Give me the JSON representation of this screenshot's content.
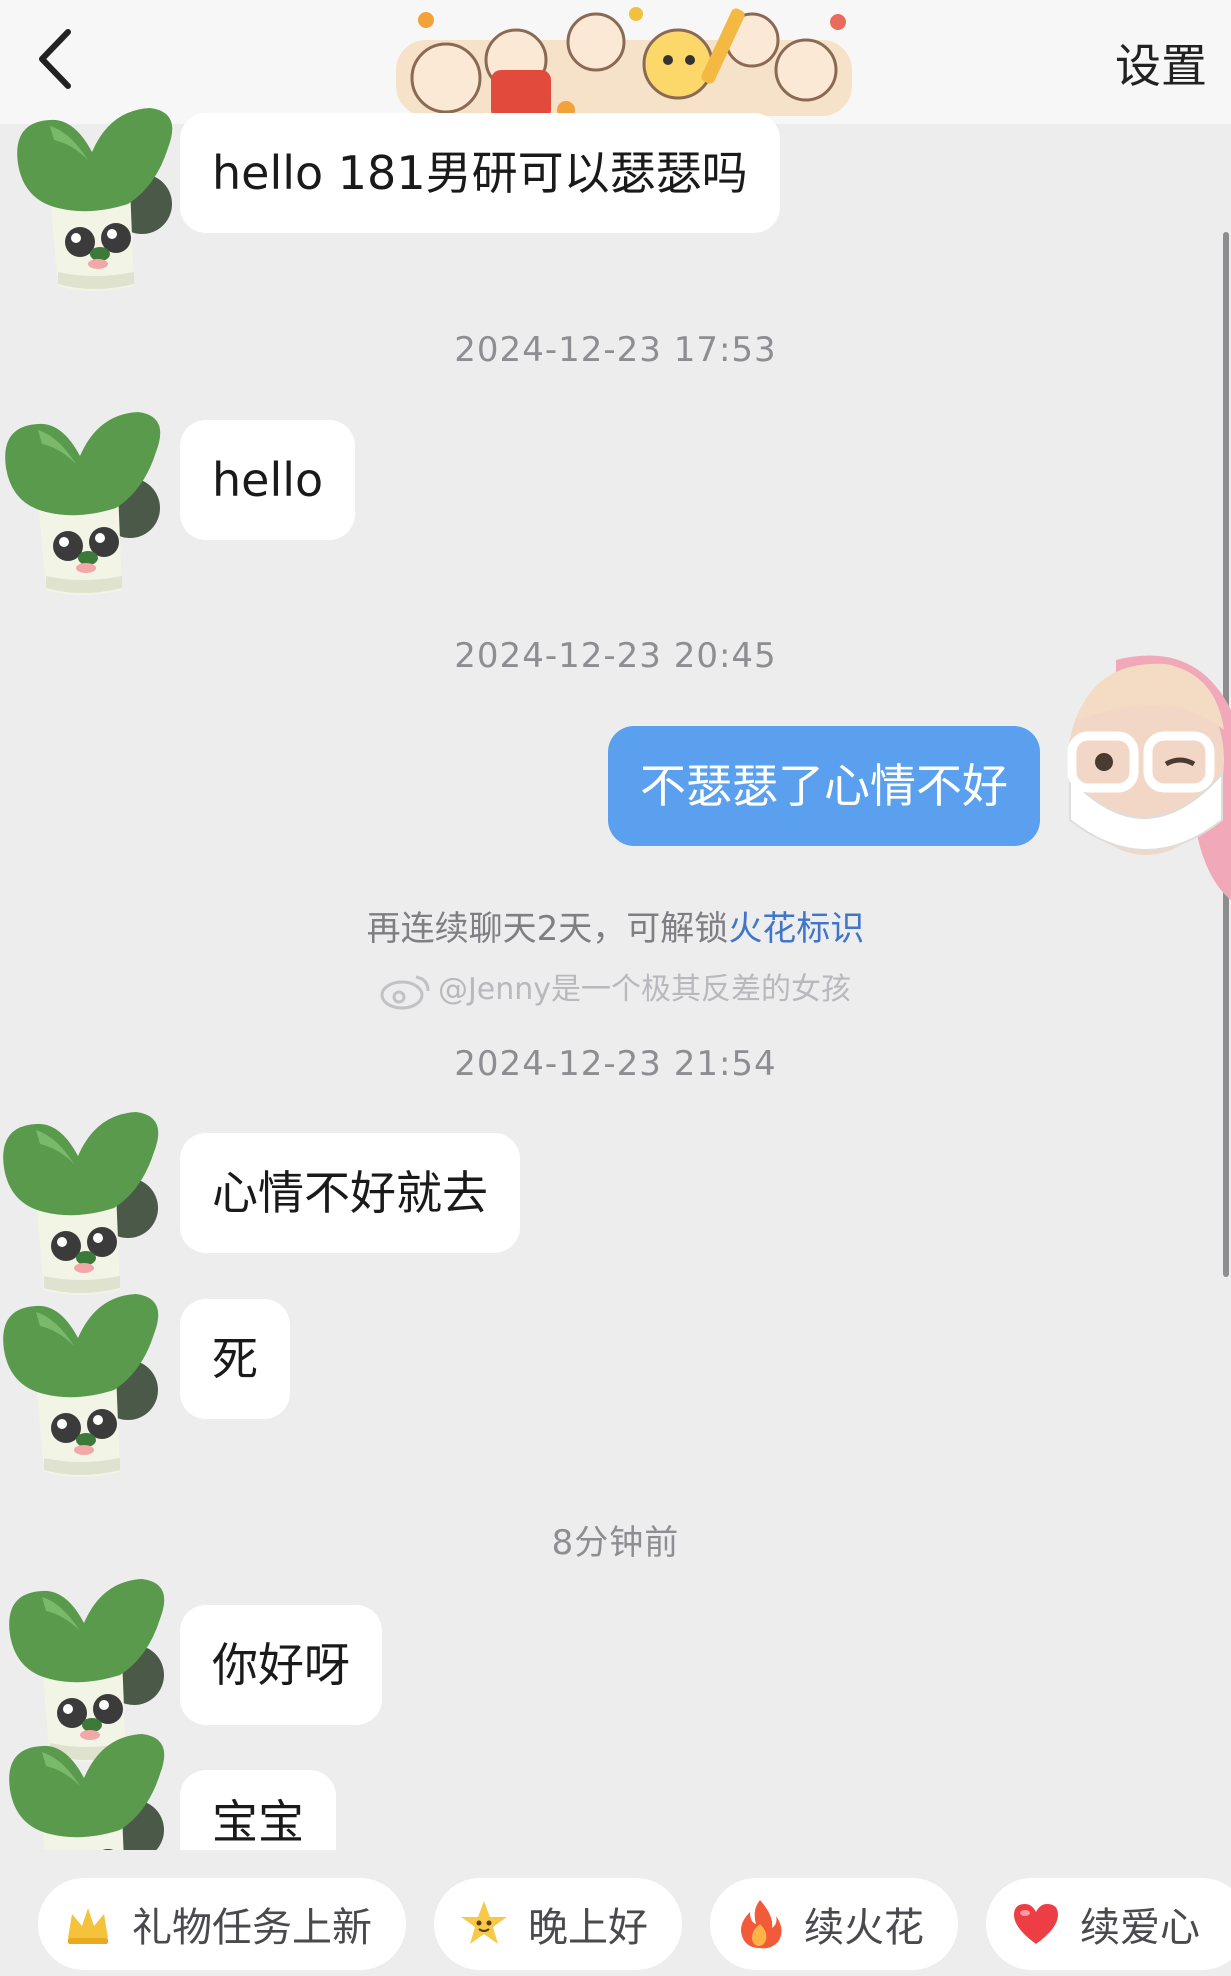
{
  "header": {
    "back_icon": "chevron-left-icon",
    "banner": "cartoon-cats-new-year-sticker",
    "settings_label": "设置"
  },
  "messages": [
    {
      "side": "left",
      "text": "hello 181男研可以瑟瑟吗",
      "avatar": "green-leek-avatar"
    },
    {
      "side": "left",
      "text": "hello",
      "avatar": "green-leek-avatar"
    },
    {
      "side": "right",
      "text": "不瑟瑟了心情不好",
      "avatar": "memoji-white-glasses-mask-avatar"
    },
    {
      "side": "left",
      "text": "心情不好就去",
      "avatar": "green-leek-avatar"
    },
    {
      "side": "left",
      "text": "死",
      "avatar": "green-leek-avatar"
    },
    {
      "side": "left",
      "text": "你好呀",
      "avatar": "green-leek-avatar"
    },
    {
      "side": "left",
      "text": "宝宝",
      "avatar": "green-leek-avatar"
    }
  ],
  "timestamps": [
    "2024-12-23 17:53",
    "2024-12-23 20:45",
    "2024-12-23 21:54",
    "8分钟前"
  ],
  "notice": {
    "prefix": "再连续聊天2天，可解锁",
    "link": "火花标识"
  },
  "watermark": "@Jenny是一个极其反差的女孩",
  "quick_replies": [
    {
      "label": "礼物任务上新",
      "icon": "crown-icon"
    },
    {
      "label": "晚上好",
      "icon": "star-face-icon"
    },
    {
      "label": "续火花",
      "icon": "fire-icon"
    },
    {
      "label": "续爱心",
      "icon": "heart-icon"
    }
  ],
  "colors": {
    "background": "#ededee",
    "my_bubble": "#5aa0ef",
    "their_bubble": "#ffffff",
    "link": "#3f76c9"
  }
}
